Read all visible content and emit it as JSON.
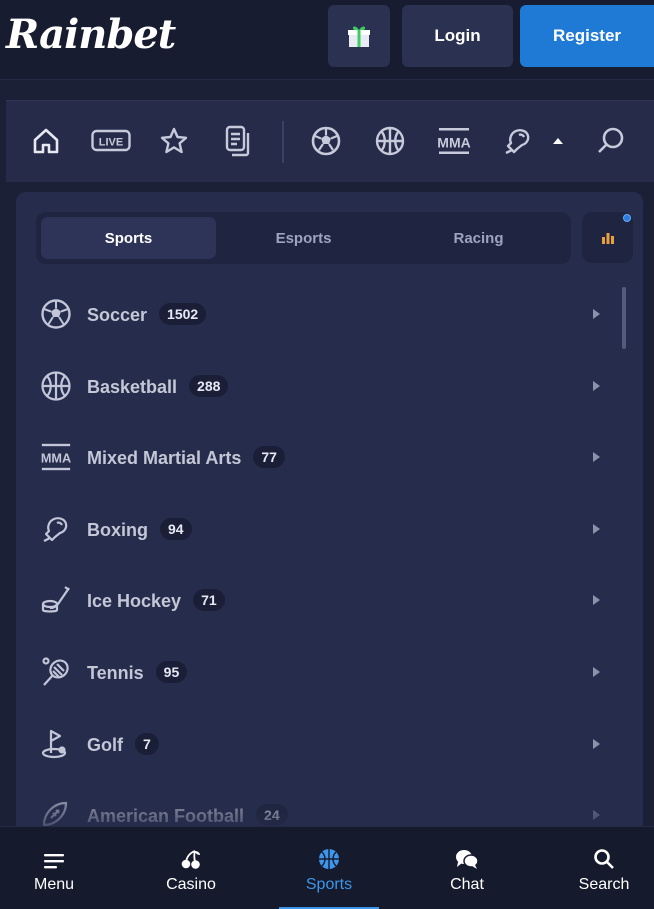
{
  "header": {
    "logo_text": "Rainbet",
    "login_label": "Login",
    "register_label": "Register"
  },
  "tabs": [
    {
      "label": "Sports",
      "active": true
    },
    {
      "label": "Esports",
      "active": false
    },
    {
      "label": "Racing",
      "active": false
    }
  ],
  "sports": [
    {
      "name": "Soccer",
      "count": "1502",
      "icon": "soccer-ball-icon"
    },
    {
      "name": "Basketball",
      "count": "288",
      "icon": "basketball-icon"
    },
    {
      "name": "Mixed Martial Arts",
      "count": "77",
      "icon": "mma-icon"
    },
    {
      "name": "Boxing",
      "count": "94",
      "icon": "boxing-glove-icon"
    },
    {
      "name": "Ice Hockey",
      "count": "71",
      "icon": "ice-hockey-icon"
    },
    {
      "name": "Tennis",
      "count": "95",
      "icon": "tennis-racket-icon"
    },
    {
      "name": "Golf",
      "count": "7",
      "icon": "golf-flag-icon"
    },
    {
      "name": "American Football",
      "count": "24",
      "icon": "american-football-icon"
    }
  ],
  "strip": {
    "live_label": "LIVE",
    "mma_label": "MMA"
  },
  "bottom_nav": [
    {
      "label": "Menu",
      "icon": "menu-icon",
      "active": false
    },
    {
      "label": "Casino",
      "icon": "cherries-icon",
      "active": false
    },
    {
      "label": "Sports",
      "icon": "basketball-icon",
      "active": true
    },
    {
      "label": "Chat",
      "icon": "chat-icon",
      "active": false
    },
    {
      "label": "Search",
      "icon": "search-icon",
      "active": false
    }
  ],
  "colors": {
    "accent": "#1f7ad6",
    "active_nav": "#3d96ea",
    "background": "#1b2036",
    "panel": "#262c4b"
  }
}
